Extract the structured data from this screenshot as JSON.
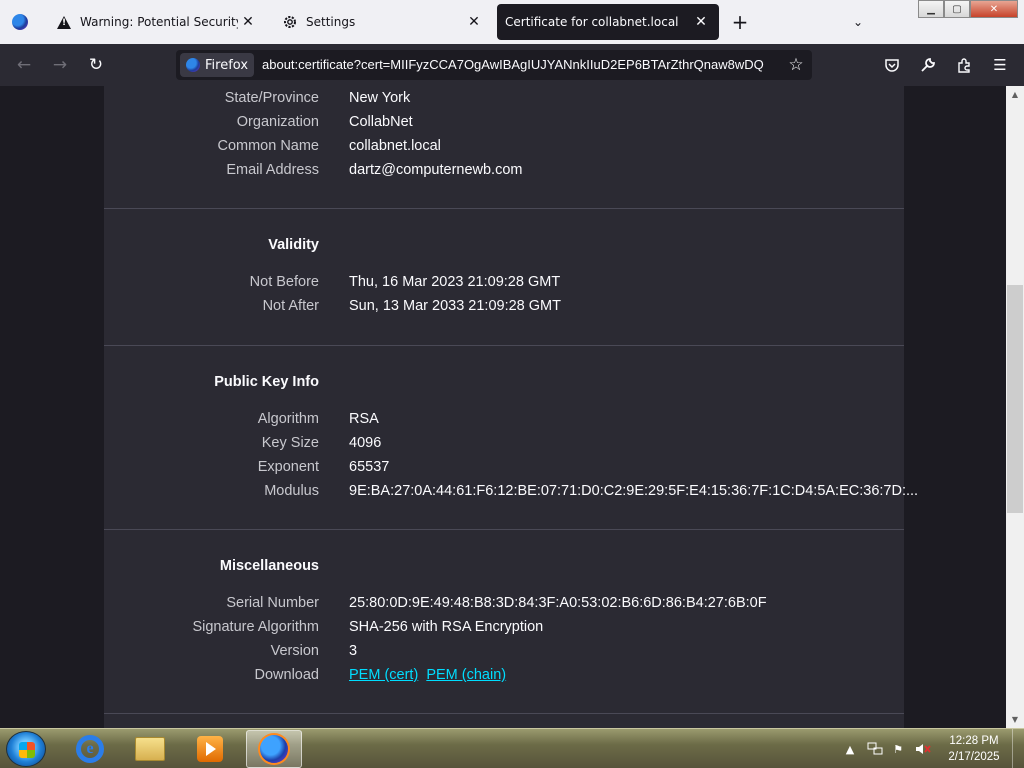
{
  "browser": {
    "tabs": [
      {
        "label": "Warning: Potential Security Risk Ahead",
        "icon": "warning-icon"
      },
      {
        "label": "Settings",
        "icon": "gear-icon"
      },
      {
        "label": "Certificate for collabnet.local",
        "icon": ""
      }
    ],
    "identity_label": "Firefox",
    "url": "about:certificate?cert=MIIFyzCCA7OgAwIBAgIUJYANnkIIuD2EP6BTArZthrQnaw8wDQ"
  },
  "certificate": {
    "subject": [
      {
        "label": "State/Province",
        "value": "New York"
      },
      {
        "label": "Organization",
        "value": "CollabNet"
      },
      {
        "label": "Common Name",
        "value": "collabnet.local"
      },
      {
        "label": "Email Address",
        "value": "dartz@computernewb.com"
      }
    ],
    "validity": {
      "title": "Validity",
      "items": [
        {
          "label": "Not Before",
          "value": "Thu, 16 Mar 2023 21:09:28 GMT"
        },
        {
          "label": "Not After",
          "value": "Sun, 13 Mar 2033 21:09:28 GMT"
        }
      ]
    },
    "public_key": {
      "title": "Public Key Info",
      "items": [
        {
          "label": "Algorithm",
          "value": "RSA"
        },
        {
          "label": "Key Size",
          "value": "4096"
        },
        {
          "label": "Exponent",
          "value": "65537"
        },
        {
          "label": "Modulus",
          "value": "9E:BA:27:0A:44:61:F6:12:BE:07:71:D0:C2:9E:29:5F:E4:15:36:7F:1C:D4:5A:EC:36:7D:..."
        }
      ]
    },
    "misc": {
      "title": "Miscellaneous",
      "items": [
        {
          "label": "Serial Number",
          "value": "25:80:0D:9E:49:48:B8:3D:84:3F:A0:53:02:B6:6D:86:B4:27:6B:0F"
        },
        {
          "label": "Signature Algorithm",
          "value": "SHA-256 with RSA Encryption"
        },
        {
          "label": "Version",
          "value": "3"
        },
        {
          "label": "Download",
          "value": ""
        }
      ],
      "download_links": [
        "PEM (cert)",
        "PEM (chain)"
      ]
    }
  },
  "taskbar": {
    "clock_time": "12:28 PM",
    "clock_date": "2/17/2025",
    "ie_glyph": "e"
  },
  "colors": {
    "content_bg": "#1c1b22",
    "card_bg": "#2b2a33",
    "link": "#00ddff"
  }
}
